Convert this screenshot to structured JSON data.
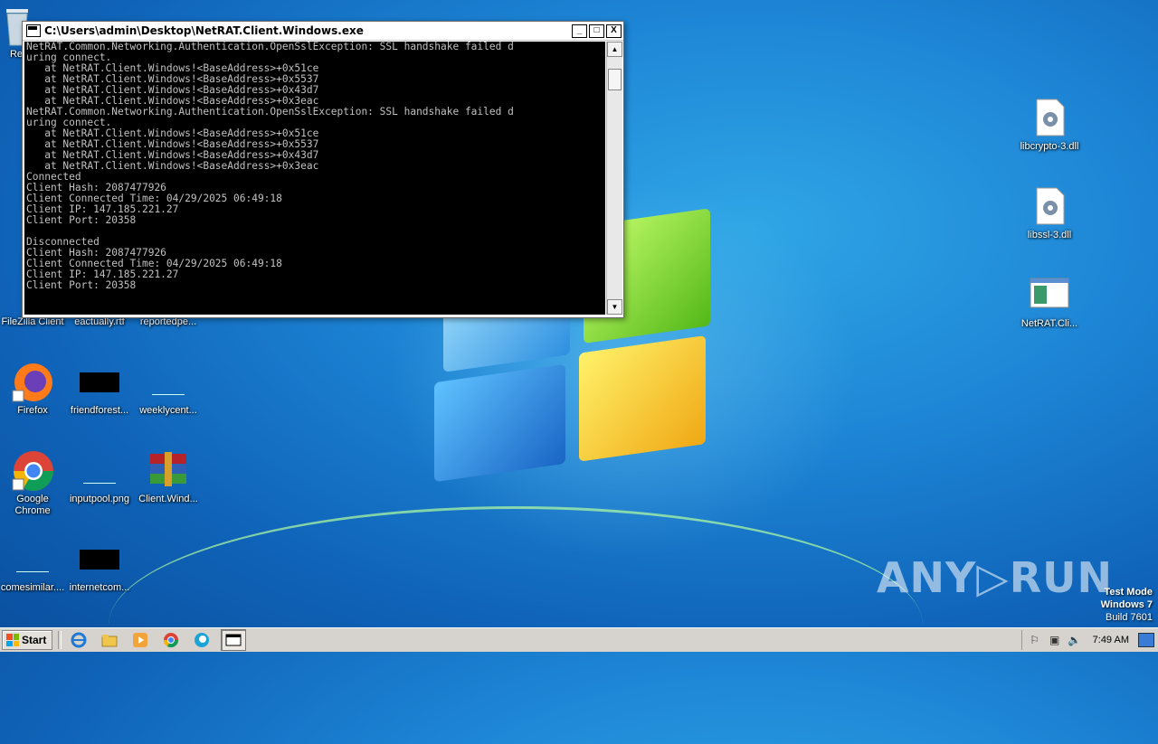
{
  "window": {
    "title": "C:\\Users\\admin\\Desktop\\NetRAT.Client.Windows.exe",
    "minimize": "_",
    "maximize": "□",
    "close": "X"
  },
  "console": {
    "lines": [
      "NetRAT.Common.Networking.Authentication.OpenSslException: SSL handshake failed d",
      "uring connect.",
      "   at NetRAT.Client.Windows!<BaseAddress>+0x51ce",
      "   at NetRAT.Client.Windows!<BaseAddress>+0x5537",
      "   at NetRAT.Client.Windows!<BaseAddress>+0x43d7",
      "   at NetRAT.Client.Windows!<BaseAddress>+0x3eac",
      "NetRAT.Common.Networking.Authentication.OpenSslException: SSL handshake failed d",
      "uring connect.",
      "   at NetRAT.Client.Windows!<BaseAddress>+0x51ce",
      "   at NetRAT.Client.Windows!<BaseAddress>+0x5537",
      "   at NetRAT.Client.Windows!<BaseAddress>+0x43d7",
      "   at NetRAT.Client.Windows!<BaseAddress>+0x3eac",
      "Connected",
      "Client Hash: 2087477926",
      "Client Connected Time: 04/29/2025 06:49:18",
      "Client IP: 147.185.221.27",
      "Client Port: 20358",
      "",
      "Disconnected",
      "Client Hash: 2087477926",
      "Client Connected Time: 04/29/2025 06:49:18",
      "Client IP: 147.185.221.27",
      "Client Port: 20358"
    ]
  },
  "desktop_icons": {
    "recycle_bin": "Re",
    "filezilla": "FileZilla Client",
    "eactually": "eactually.rtf",
    "reportedpe": "reportedpe...",
    "firefox": "Firefox",
    "friendforest": "friendforest...",
    "weeklycent": "weeklycent...",
    "chrome": "Google Chrome",
    "inputpool": "inputpool.png",
    "clientwind": "Client.Wind...",
    "comesimilar": "comesimilar....",
    "internetcom": "internetcom...",
    "libcrypto": "libcrypto-3.dll",
    "libssl": "libssl-3.dll",
    "netratcli": "NetRAT.Cli..."
  },
  "taskbar": {
    "start_label": "Start",
    "clock": "7:49 AM"
  },
  "watermark": "ANY▷RUN",
  "test_mode": {
    "line1": "Test Mode",
    "line2": "Windows 7",
    "line3": "Build 7601"
  }
}
